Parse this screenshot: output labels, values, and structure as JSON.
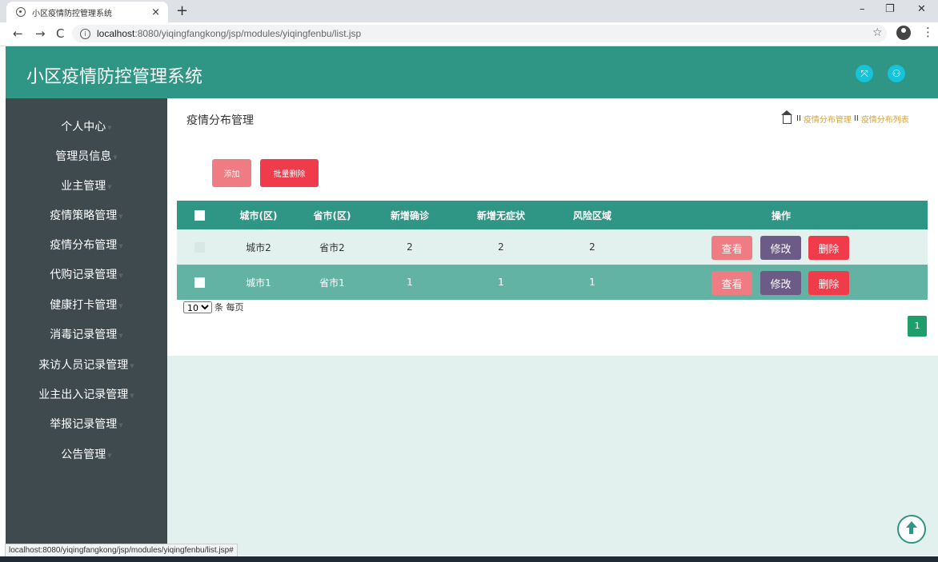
{
  "browser": {
    "tab_title": "小区疫情防控管理系统",
    "tab_close": "×",
    "new_tab": "+",
    "url_host": "localhost",
    "url_rest": ":8080/yiqingfangkong/jsp/modules/yiqingfenbu/list.jsp",
    "back": "←",
    "forward": "→",
    "reload": "C",
    "star": "☆",
    "menu": "⋮",
    "minimize": "–",
    "maximize": "❐",
    "close": "✕",
    "status_url": "localhost:8080/yiqingfangkong/jsp/modules/yiqingfenbu/list.jsp#"
  },
  "header": {
    "title": "小区疫情防控管理系统",
    "fullscreen_icon": "⤧",
    "user_icon": "⚇"
  },
  "sidebar": {
    "items": [
      {
        "label": "个人中心"
      },
      {
        "label": "管理员信息"
      },
      {
        "label": "业主管理"
      },
      {
        "label": "疫情策略管理"
      },
      {
        "label": "疫情分布管理"
      },
      {
        "label": "代购记录管理"
      },
      {
        "label": "健康打卡管理"
      },
      {
        "label": "消毒记录管理"
      },
      {
        "label": "来访人员记录管理"
      },
      {
        "label": "业主出入记录管理"
      },
      {
        "label": "举报记录管理"
      },
      {
        "label": "公告管理"
      }
    ],
    "arrow": "▼"
  },
  "main": {
    "title": "疫情分布管理",
    "breadcrumb": [
      "疫情分布管理",
      "疫情分布列表"
    ],
    "breadcrumb_sep": "II",
    "add_label": "添加",
    "bulk_delete_label": "批量删除",
    "table": {
      "headers": [
        "城市(区)",
        "省市(区)",
        "新增确诊",
        "新增无症状",
        "风险区域",
        "操作"
      ],
      "rows": [
        {
          "city": "城市2",
          "province": "省市2",
          "confirmed": "2",
          "asymptomatic": "2",
          "risk": "2"
        },
        {
          "city": "城市1",
          "province": "省市1",
          "confirmed": "1",
          "asymptomatic": "1",
          "risk": "1"
        }
      ],
      "view_label": "查看",
      "edit_label": "修改",
      "delete_label": "删除"
    },
    "page_size": "10",
    "page_size_suffix": "条 每页",
    "current_page": "1"
  },
  "colors": {
    "primary": "#2f9584",
    "sidebar": "#3f4a4e",
    "view": "#ef7c82",
    "edit": "#6b5b86",
    "delete": "#f03b4b"
  }
}
